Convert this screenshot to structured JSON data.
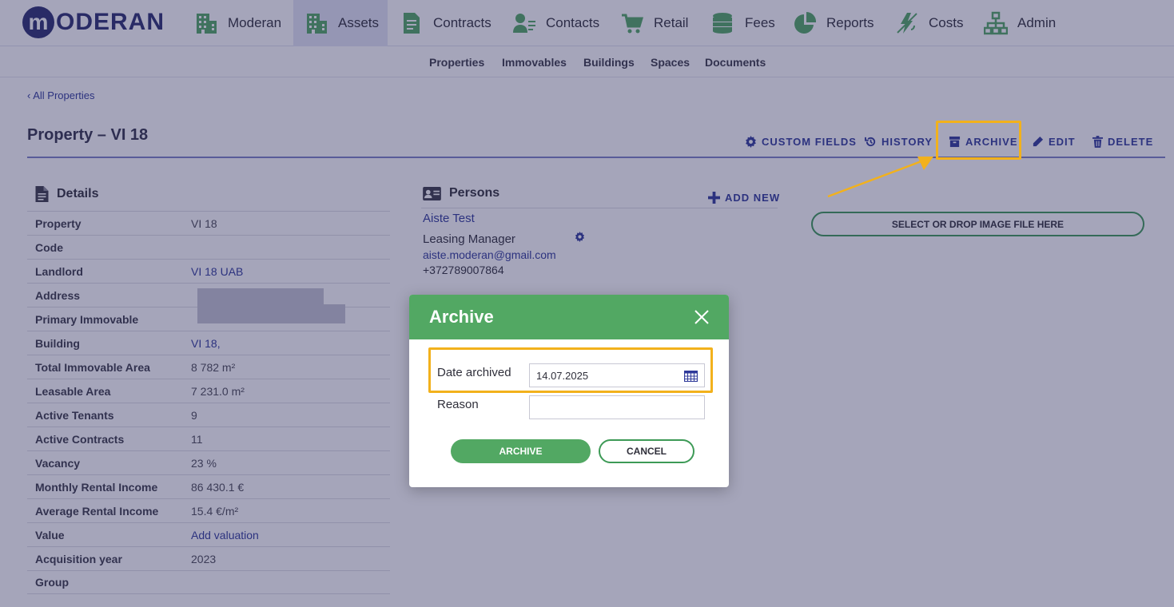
{
  "brand": {
    "logo_letter": "m",
    "logo_text": "ODERAN"
  },
  "nav": [
    {
      "label": "Moderan",
      "icon": "building-icon"
    },
    {
      "label": "Assets",
      "icon": "building-icon"
    },
    {
      "label": "Contracts",
      "icon": "document-icon"
    },
    {
      "label": "Contacts",
      "icon": "contact-card-icon"
    },
    {
      "label": "Retail",
      "icon": "cart-icon"
    },
    {
      "label": "Fees",
      "icon": "coins-icon"
    },
    {
      "label": "Reports",
      "icon": "pie-chart-icon"
    },
    {
      "label": "Costs",
      "icon": "energy-icon"
    },
    {
      "label": "Admin",
      "icon": "org-chart-icon"
    }
  ],
  "subnav": [
    "Properties",
    "Immovables",
    "Buildings",
    "Spaces",
    "Documents"
  ],
  "breadcrumb": {
    "back": "‹ All Properties"
  },
  "page": {
    "title": "Property – VI 18"
  },
  "actions": {
    "custom_fields": "CUSTOM FIELDS",
    "history": "HISTORY",
    "archive": "ARCHIVE",
    "edit": "EDIT",
    "delete": "DELETE"
  },
  "details": {
    "heading": "Details",
    "rows": [
      {
        "label": "Property",
        "value": "VI 18"
      },
      {
        "label": "Code",
        "value": ""
      },
      {
        "label": "Landlord",
        "value": "VI 18 UAB"
      },
      {
        "label": "Address",
        "value": ""
      },
      {
        "label": "Primary Immovable",
        "value": ""
      },
      {
        "label": "Building",
        "value": "VI 18,"
      },
      {
        "label": "Total Immovable Area",
        "value": "8 782 m²"
      },
      {
        "label": "Leasable Area",
        "value": "7 231.0 m²"
      },
      {
        "label": "Active Tenants",
        "value": "9"
      },
      {
        "label": "Active Contracts",
        "value": "11"
      },
      {
        "label": "Vacancy",
        "value": "23 %"
      },
      {
        "label": "Monthly Rental Income",
        "value": "86 430.1 €"
      },
      {
        "label": "Average Rental Income",
        "value": "15.4 €/m²"
      },
      {
        "label": "Value",
        "value": "Add valuation"
      },
      {
        "label": "Acquisition year",
        "value": "2023"
      },
      {
        "label": "Group",
        "value": ""
      }
    ]
  },
  "persons": {
    "heading": "Persons",
    "add_new": "ADD NEW",
    "person": {
      "name": "Aiste Test",
      "role": "Leasing Manager",
      "email": "aiste.moderan@gmail.com",
      "phone": "+372789007864"
    }
  },
  "image_drop": {
    "label": "SELECT OR DROP IMAGE FILE HERE"
  },
  "modal": {
    "title": "Archive",
    "date_label": "Date archived",
    "date_value": "14.07.2025",
    "reason_label": "Reason",
    "reason_value": "",
    "confirm": "ARCHIVE",
    "cancel": "CANCEL"
  },
  "colors": {
    "brand_navy": "#2a2d6e",
    "link_blue": "#2f3a9a",
    "green": "#52a863",
    "highlight": "#f2b11c"
  }
}
